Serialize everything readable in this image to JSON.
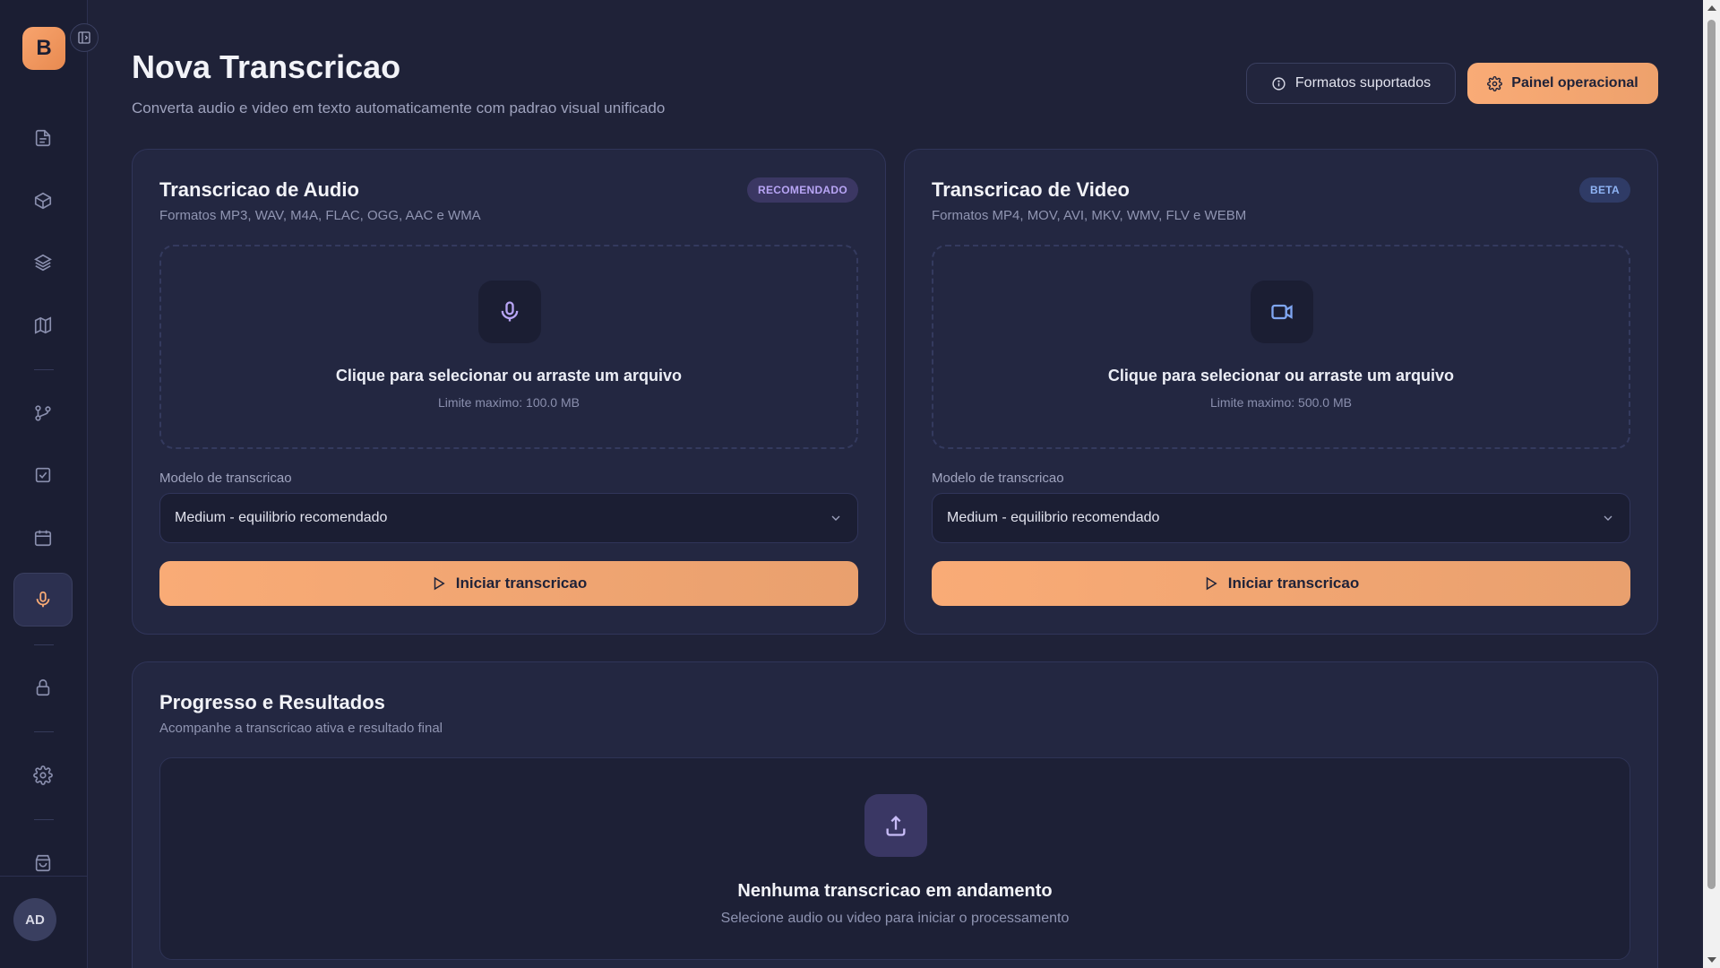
{
  "sidebar": {
    "logo_letter": "B",
    "items": [
      {
        "icon": "file-icon"
      },
      {
        "icon": "box-icon"
      },
      {
        "icon": "layers-icon"
      },
      {
        "icon": "map-icon"
      },
      {
        "icon": "git-branch-icon"
      },
      {
        "icon": "check-square-icon"
      },
      {
        "icon": "calendar-icon"
      },
      {
        "icon": "mic-icon",
        "active": true
      },
      {
        "icon": "lock-icon"
      },
      {
        "icon": "gear-icon"
      },
      {
        "icon": "shopping-bag-icon"
      }
    ],
    "avatar_initials": "AD"
  },
  "header": {
    "title": "Nova Transcricao",
    "subtitle": "Converta audio e video em texto automaticamente com padrao visual unificado",
    "formats_button": "Formatos suportados",
    "panel_button": "Painel operacional"
  },
  "audio_card": {
    "title": "Transcricao de Audio",
    "subtitle": "Formatos MP3, WAV, M4A, FLAC, OGG, AAC e WMA",
    "badge": "RECOMENDADO",
    "dropzone_title": "Clique para selecionar ou arraste um arquivo",
    "dropzone_limit": "Limite maximo: 100.0 MB",
    "model_label": "Modelo de transcricao",
    "model_value": "Medium - equilibrio recomendado",
    "start_button": "Iniciar transcricao"
  },
  "video_card": {
    "title": "Transcricao de Video",
    "subtitle": "Formatos MP4, MOV, AVI, MKV, WMV, FLV e WEBM",
    "badge": "BETA",
    "dropzone_title": "Clique para selecionar ou arraste um arquivo",
    "dropzone_limit": "Limite maximo: 500.0 MB",
    "model_label": "Modelo de transcricao",
    "model_value": "Medium - equilibrio recomendado",
    "start_button": "Iniciar transcricao"
  },
  "progress_card": {
    "title": "Progresso e Resultados",
    "subtitle": "Acompanhe a transcricao ativa e resultado final",
    "empty_title": "Nenhuma transcricao em andamento",
    "empty_subtitle": "Selecione audio ou video para iniciar o processamento"
  },
  "colors": {
    "accent": "#f9ab76",
    "background": "#1f2238",
    "card": "#232741",
    "badge_recommended": "#b8a5f5",
    "badge_beta": "#8fb4f5"
  }
}
